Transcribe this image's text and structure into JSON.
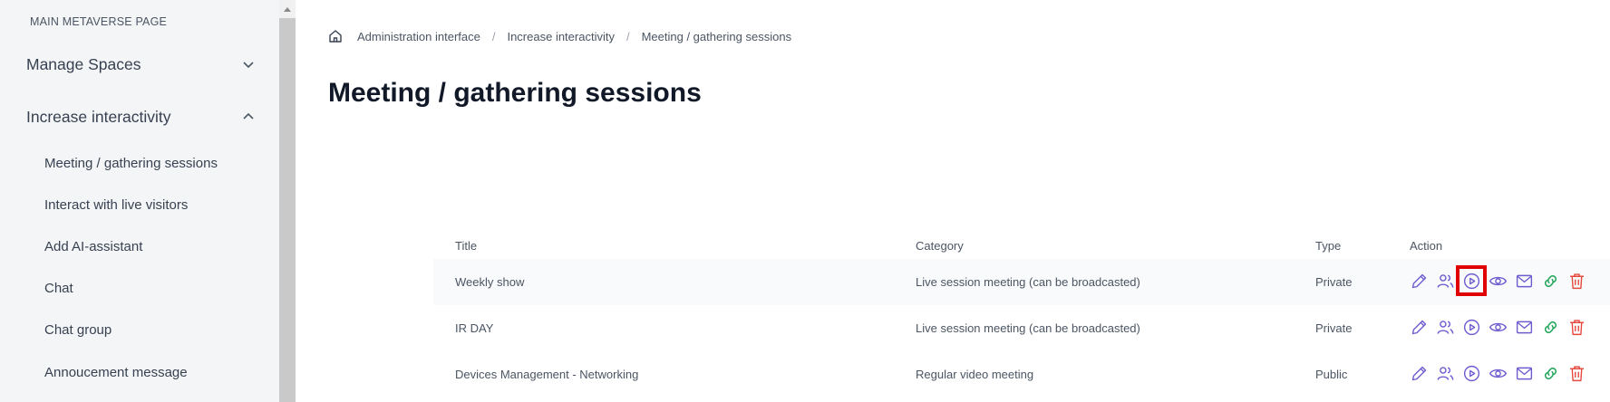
{
  "sidebar": {
    "section_label": "MAIN METAVERSE PAGE",
    "groups": [
      {
        "label": "Manage Spaces",
        "expanded": false
      },
      {
        "label": "Increase interactivity",
        "expanded": true
      }
    ],
    "items": [
      {
        "label": "Meeting / gathering sessions"
      },
      {
        "label": "Interact with live visitors"
      },
      {
        "label": "Add AI-assistant"
      },
      {
        "label": "Chat"
      },
      {
        "label": "Chat group"
      },
      {
        "label": "Annoucement message"
      }
    ]
  },
  "breadcrumb": {
    "items": [
      "Administration interface",
      "Increase interactivity",
      "Meeting / gathering sessions"
    ]
  },
  "page": {
    "title": "Meeting / gathering sessions"
  },
  "table": {
    "columns": [
      "Title",
      "Category",
      "Type",
      "Action"
    ],
    "rows": [
      {
        "title": "Weekly show",
        "category": "Live session meeting (can be broadcasted)",
        "type": "Private"
      },
      {
        "title": "IR DAY",
        "category": "Live session meeting (can be broadcasted)",
        "type": "Private"
      },
      {
        "title": "Devices Management - Networking",
        "category": "Regular video meeting",
        "type": "Public"
      }
    ],
    "action_icons": [
      "edit-icon",
      "participants-icon",
      "play-icon",
      "view-icon",
      "mail-icon",
      "link-icon",
      "delete-icon"
    ]
  },
  "colors": {
    "accent": "#6d5bd0",
    "link_green": "#22a55b",
    "delete_red": "#e5483d",
    "highlight": "#e00000"
  }
}
